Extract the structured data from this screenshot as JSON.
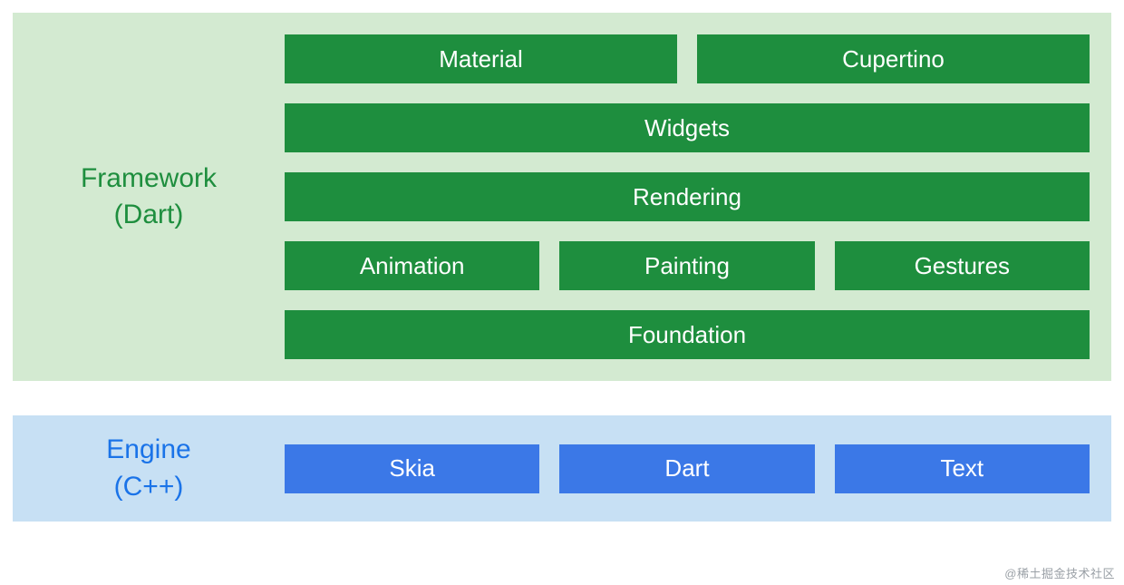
{
  "framework": {
    "label_line1": "Framework",
    "label_line2": "(Dart)",
    "rows": {
      "row1": {
        "material": "Material",
        "cupertino": "Cupertino"
      },
      "row2": {
        "widgets": "Widgets"
      },
      "row3": {
        "rendering": "Rendering"
      },
      "row4": {
        "animation": "Animation",
        "painting": "Painting",
        "gestures": "Gestures"
      },
      "row5": {
        "foundation": "Foundation"
      }
    }
  },
  "engine": {
    "label_line1": "Engine",
    "label_line2": "(C++)",
    "row": {
      "skia": "Skia",
      "dart": "Dart",
      "text": "Text"
    }
  },
  "watermark": "@稀土掘金技术社区",
  "colors": {
    "framework_bg": "#d3ead1",
    "framework_block": "#1e8e3e",
    "engine_bg": "#c7e0f4",
    "engine_block": "#3b78e7"
  }
}
